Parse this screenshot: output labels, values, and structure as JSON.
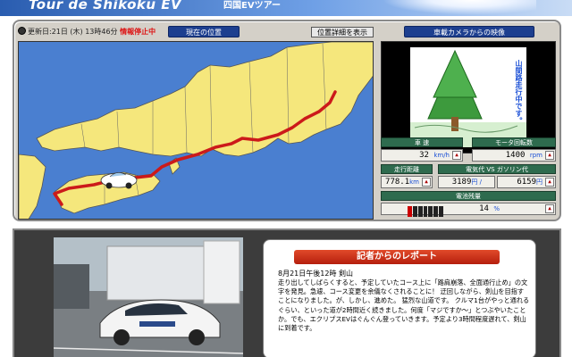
{
  "banner": {
    "title": "Tour de Shikoku EV",
    "subtitle": "四国EVツアー"
  },
  "status": {
    "updated": "更新日:21日 (木) 13時46分",
    "warning": "情報停止中"
  },
  "tabs": {
    "current_position": "現在の位置",
    "position_details": "位置詳細を表示",
    "camera": "車載カメラからの映像"
  },
  "camera": {
    "caption": "山間路走行中です。"
  },
  "meters": {
    "speed_label": "車 速",
    "speed_value": "32",
    "speed_unit": "km/h",
    "motor_label": "モータ回転数",
    "motor_value": "1400",
    "motor_unit": "rpm",
    "distance_label": "走行距離",
    "distance_value": "778.1",
    "distance_unit": "km",
    "cost_label": "電気代 VS ガソリン代",
    "electric_value": "3189",
    "electric_unit": "円 /",
    "gas_value": "6159",
    "gas_unit": "円",
    "battery_label": "電池残量",
    "battery_value": "14",
    "battery_unit": "%",
    "battery_fraction": 0.14
  },
  "report": {
    "title": "記者からのレポート",
    "date": "8月21日午後12時  剣山",
    "body": "走り出してしばらくすると、予定していたコース上に「路肩崩落、全面通行止め」の文字を発見。急遽、コース変更を余儀なくされることに！ 迂回しながら、剣山を目指すことになりました。が、しかし、進めた。 猛烈な山道です。 クルマ1台がやっと通れるぐらい、といった道が2時間近く続きました。何度「マジですか～」とつぶやいたことか。でも、エクリプスEVはぐんぐん登っていきます。予定より3時間程度遅れて、剣山に到着です。"
  },
  "colors": {
    "route": "#cc1a1a",
    "land": "#f5e77c",
    "sea": "#4a7fd0",
    "tab_blue": "#1d3f8f",
    "meter_green": "#2e6b4e"
  }
}
